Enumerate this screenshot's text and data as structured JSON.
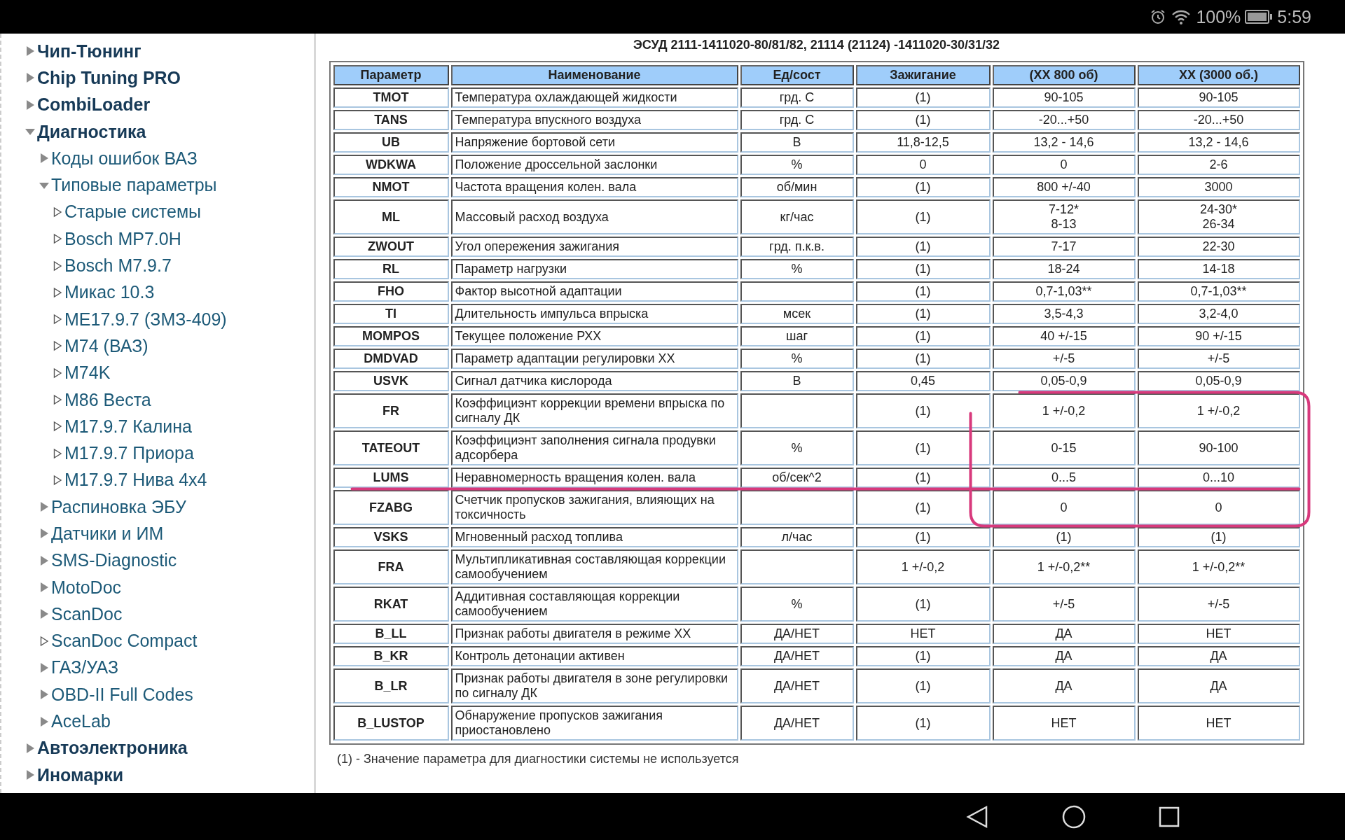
{
  "status_bar": {
    "battery": "100%",
    "time": "5:59"
  },
  "sidebar": {
    "items": [
      {
        "label": "Чип-Тюнинг",
        "kind": "folder",
        "expanded": false
      },
      {
        "label": "Chip Tuning PRO",
        "kind": "folder",
        "expanded": false
      },
      {
        "label": "CombiLoader",
        "kind": "folder",
        "expanded": false
      },
      {
        "label": "Диагностика",
        "kind": "folder",
        "expanded": true,
        "children": [
          {
            "label": "Коды ошибок ВАЗ",
            "kind": "folder",
            "expanded": false
          },
          {
            "label": "Типовые параметры",
            "kind": "folder",
            "expanded": true,
            "children": [
              {
                "label": "Старые системы",
                "kind": "page"
              },
              {
                "label": "Bosch MP7.0H",
                "kind": "page"
              },
              {
                "label": "Bosch M7.9.7",
                "kind": "page"
              },
              {
                "label": "Микас 10.3",
                "kind": "page"
              },
              {
                "label": "ME17.9.7 (ЗМЗ-409)",
                "kind": "page"
              },
              {
                "label": "M74 (ВАЗ)",
                "kind": "page"
              },
              {
                "label": "M74K",
                "kind": "page"
              },
              {
                "label": "M86 Веста",
                "kind": "page"
              },
              {
                "label": "M17.9.7 Калина",
                "kind": "page"
              },
              {
                "label": "M17.9.7 Приора",
                "kind": "page"
              },
              {
                "label": "M17.9.7 Нива 4х4",
                "kind": "page"
              }
            ]
          },
          {
            "label": "Распиновка ЭБУ",
            "kind": "folder",
            "expanded": false
          },
          {
            "label": "Датчики и ИМ",
            "kind": "folder",
            "expanded": false
          },
          {
            "label": "SMS-Diagnostic",
            "kind": "folder",
            "expanded": false
          },
          {
            "label": "MotoDoc",
            "kind": "folder",
            "expanded": false
          },
          {
            "label": "ScanDoc",
            "kind": "folder",
            "expanded": false
          },
          {
            "label": "ScanDoc Compact",
            "kind": "page"
          },
          {
            "label": "ГАЗ/УАЗ",
            "kind": "folder",
            "expanded": false
          },
          {
            "label": "OBD-II Full Codes",
            "kind": "folder",
            "expanded": false
          },
          {
            "label": "AceLab",
            "kind": "folder",
            "expanded": false
          }
        ]
      },
      {
        "label": "Автоэлектроника",
        "kind": "folder",
        "expanded": false
      },
      {
        "label": "Иномарки",
        "kind": "folder",
        "expanded": false
      }
    ]
  },
  "content": {
    "title": "ЭСУД 2111-1411020-80/81/82, 21114 (21124) -1411020-30/31/32",
    "table": {
      "columns": [
        "Параметр",
        "Наименование",
        "Ед/сост",
        "Зажигание",
        "(ХХ 800 об)",
        "ХХ (3000 об.)"
      ],
      "rows": [
        [
          "TMOT",
          "Температура охлаждающей жидкости",
          "грд. С",
          "(1)",
          "90-105",
          "90-105"
        ],
        [
          "TANS",
          "Температура впускного воздуха",
          "грд. С",
          "(1)",
          "-20...+50",
          "-20...+50"
        ],
        [
          "UB",
          "Напряжение бортовой сети",
          "В",
          "11,8-12,5",
          "13,2 - 14,6",
          "13,2 - 14,6"
        ],
        [
          "WDKWA",
          "Положение дроссельной заслонки",
          "%",
          "0",
          "0",
          "2-6"
        ],
        [
          "NMOT",
          "Частота вращения колен. вала",
          "об/мин",
          "(1)",
          "800 +/-40",
          "3000"
        ],
        [
          "ML",
          "Массовый расход воздуха",
          "кг/час",
          "(1)",
          "7-12*\n8-13",
          "24-30*\n26-34"
        ],
        [
          "ZWOUT",
          "Угол опережения зажигания",
          "грд. п.к.в.",
          "(1)",
          "7-17",
          "22-30"
        ],
        [
          "RL",
          "Параметр нагрузки",
          "%",
          "(1)",
          "18-24",
          "14-18"
        ],
        [
          "FHO",
          "Фактор высотной адаптации",
          "",
          "(1)",
          "0,7-1,03**",
          "0,7-1,03**"
        ],
        [
          "TI",
          "Длительность импульса впрыска",
          "мсек",
          "(1)",
          "3,5-4,3",
          "3,2-4,0"
        ],
        [
          "MOMPOS",
          "Текущее положение РХХ",
          "шаг",
          "(1)",
          "40 +/-15",
          "90 +/-15"
        ],
        [
          "DMDVAD",
          "Параметр адаптации регулировки ХХ",
          "%",
          "(1)",
          "+/-5",
          "+/-5"
        ],
        [
          "USVK",
          "Сигнал датчика кислорода",
          "В",
          "0,45",
          "0,05-0,9",
          "0,05-0,9"
        ],
        [
          "FR",
          "Коэффициэнт коррекции времени впрыска по сигналу ДК",
          "",
          "(1)",
          "1 +/-0,2",
          "1 +/-0,2"
        ],
        [
          "TATEOUT",
          "Коэффициэнт заполнения сигнала продувки адсорбера",
          "%",
          "(1)",
          "0-15",
          "90-100"
        ],
        [
          "LUMS",
          "Неравномерность вращения колен. вала",
          "об/сек^2",
          "(1)",
          "0...5",
          "0...10"
        ],
        [
          "FZABG",
          "Счетчик пропусков зажигания, влияющих на токсичность",
          "",
          "(1)",
          "0",
          "0"
        ],
        [
          "VSKS",
          "Мгновенный расход топлива",
          "л/час",
          "(1)",
          "(1)",
          "(1)"
        ],
        [
          "FRA",
          "Мультипликативная составляющая коррекции самообучением",
          "",
          "1 +/-0,2",
          "1 +/-0,2**",
          "1 +/-0,2**"
        ],
        [
          "RKAT",
          "Аддитивная составляющая коррекции самообучением",
          "%",
          "(1)",
          "+/-5",
          "+/-5"
        ],
        [
          "B_LL",
          "Признак работы двигателя в режиме ХХ",
          "ДА/НЕТ",
          "НЕТ",
          "ДА",
          "НЕТ"
        ],
        [
          "B_KR",
          "Контроль детонации активен",
          "ДА/НЕТ",
          "(1)",
          "ДА",
          "ДА"
        ],
        [
          "B_LR",
          "Признак работы двигателя в зоне регулировки по сигналу ДК",
          "ДА/НЕТ",
          "(1)",
          "ДА",
          "ДА"
        ],
        [
          "B_LUSTOP",
          "Обнаружение пропусков зажигания приостановлено",
          "ДА/НЕТ",
          "(1)",
          "НЕТ",
          "НЕТ"
        ]
      ]
    },
    "footnote": "(1) - Значение параметра для диагностики системы не используется"
  }
}
